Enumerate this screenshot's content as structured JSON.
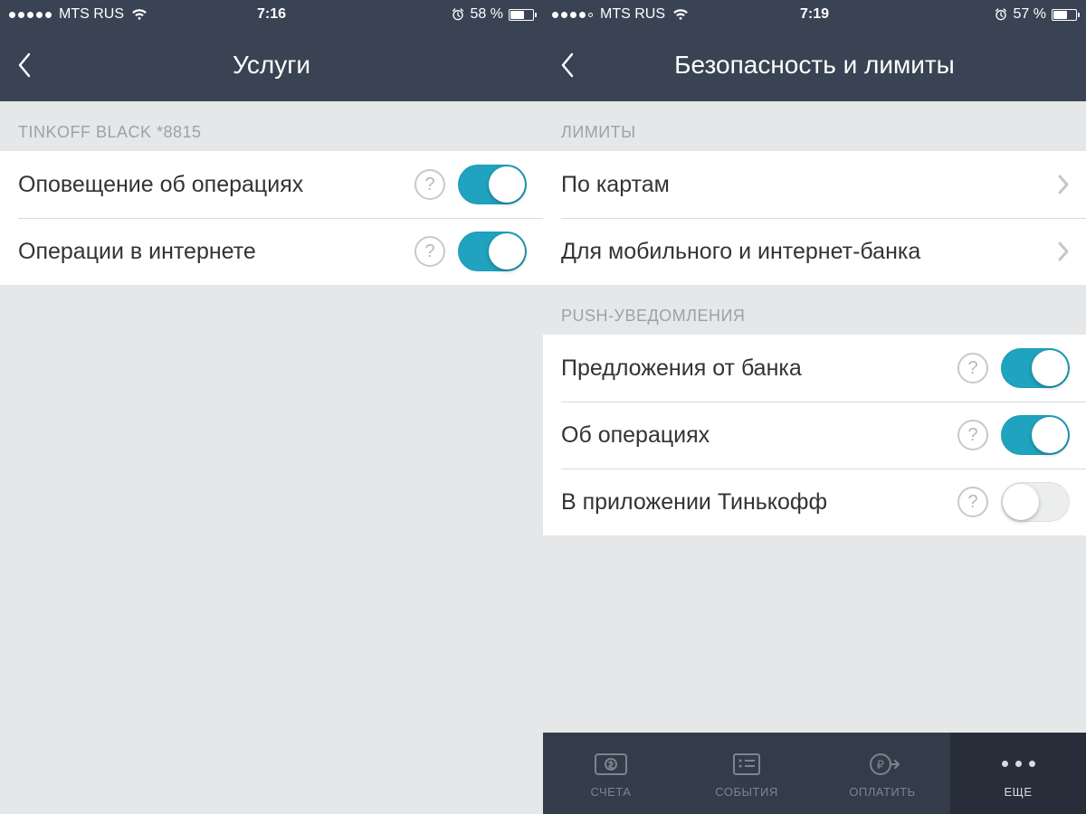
{
  "left": {
    "status": {
      "carrier": "MTS RUS",
      "time": "7:16",
      "battery_text": "58 %",
      "battery_pct": 58,
      "signal_filled": 5
    },
    "nav": {
      "title": "Услуги"
    },
    "section1": {
      "header": "TINKOFF BLACK *8815",
      "rows": [
        {
          "label": "Оповещение об операциях",
          "help": "?",
          "toggle": true
        },
        {
          "label": "Операции в интернете",
          "help": "?",
          "toggle": true
        }
      ]
    }
  },
  "right": {
    "status": {
      "carrier": "MTS RUS",
      "time": "7:19",
      "battery_text": "57 %",
      "battery_pct": 57,
      "signal_filled": 4
    },
    "nav": {
      "title": "Безопасность и лимиты"
    },
    "section1": {
      "header": "ЛИМИТЫ",
      "rows": [
        {
          "label": "По картам"
        },
        {
          "label": "Для мобильного и интернет-банка"
        }
      ]
    },
    "section2": {
      "header": "PUSH-УВЕДОМЛЕНИЯ",
      "rows": [
        {
          "label": "Предложения от банка",
          "help": "?",
          "toggle": true
        },
        {
          "label": "Об операциях",
          "help": "?",
          "toggle": true
        },
        {
          "label": "В приложении Тинькофф",
          "help": "?",
          "toggle": false
        }
      ]
    },
    "tabs": [
      {
        "label": "СЧЕТА"
      },
      {
        "label": "СОБЫТИЯ"
      },
      {
        "label": "ОПЛАТИТЬ"
      },
      {
        "label": "ЕЩЕ",
        "active": true
      }
    ]
  }
}
